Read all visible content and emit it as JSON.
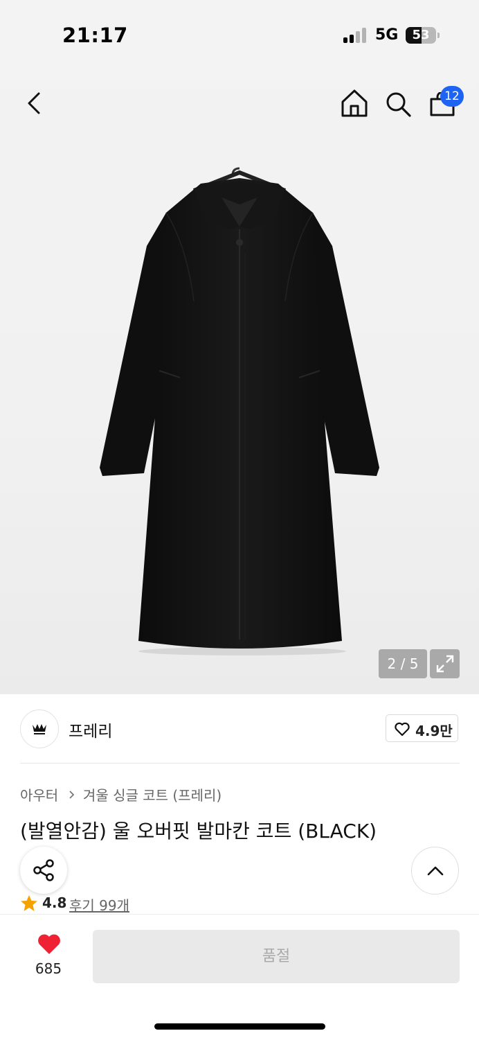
{
  "status_bar": {
    "time": "21:17",
    "network": "5G",
    "battery": "53",
    "battery_level": 0.53
  },
  "nav": {
    "cart_count": "12",
    "icons": [
      "back-arrow-icon",
      "home-icon",
      "search-icon",
      "shopping-bag-icon"
    ]
  },
  "gallery": {
    "counter": "2 / 5"
  },
  "brand": {
    "name": "프레리",
    "like_count": "4.9만"
  },
  "product": {
    "breadcrumb": [
      "아우터",
      "겨울 싱글 코트 (프레리)"
    ],
    "title": "(발열안감) 울 오버핏 발마칸 코트 (BLACK)",
    "rating": "4.8",
    "reviews": "후기 99개"
  },
  "bottom_bar": {
    "wish_count": "685",
    "status_button": "품절"
  },
  "colors": {
    "accent_blue": "#1f63f2",
    "heart_red": "#ee2233",
    "star_orange": "#f5a100",
    "disabled_bg": "#e9e9e9"
  }
}
